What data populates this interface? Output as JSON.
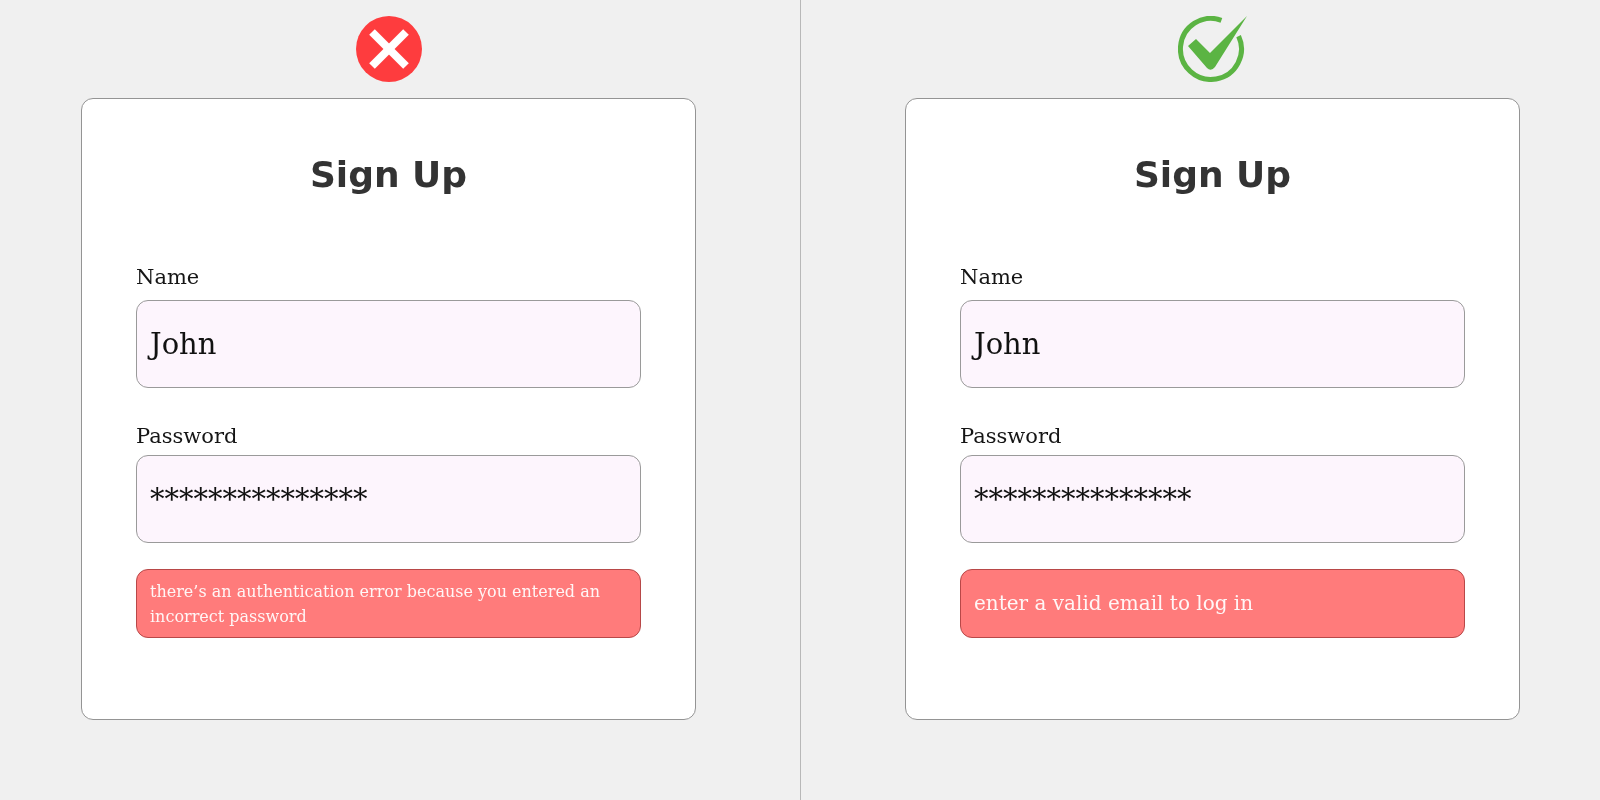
{
  "panels": [
    {
      "correct": false,
      "title": "Sign Up",
      "fields": [
        {
          "label": "Name",
          "value": "John"
        },
        {
          "label": "Password",
          "value": "***************"
        }
      ],
      "error": "there’s an authentication error because you entered an incorrect password"
    },
    {
      "correct": true,
      "title": "Sign Up",
      "fields": [
        {
          "label": "Name",
          "value": "John"
        },
        {
          "label": "Password",
          "value": "***************"
        }
      ],
      "error": "enter a valid email to log in"
    }
  ]
}
